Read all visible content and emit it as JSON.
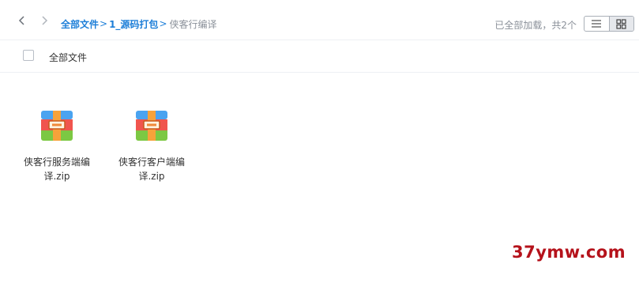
{
  "breadcrumb": {
    "items": [
      "全部文件",
      "1_源码打包"
    ],
    "separator": ">",
    "current": "侠客行编译"
  },
  "status": {
    "load_text": "已全部加载，共2个"
  },
  "view_toggle": {
    "options": [
      "list-icon",
      "grid-icon"
    ],
    "active": "grid"
  },
  "list_header": {
    "title": "全部文件"
  },
  "files": [
    {
      "name_line1": "侠客行服务端编",
      "name_line2": "译.zip",
      "icon": "zip-archive-icon"
    },
    {
      "name_line1": "侠客行客户端编",
      "name_line2": "译.zip",
      "icon": "zip-archive-icon"
    }
  ],
  "watermark": {
    "text": "37ymw.com",
    "color": "#b5121b"
  },
  "colors": {
    "accent": "#1e7fd8",
    "muted": "#8a9099"
  }
}
